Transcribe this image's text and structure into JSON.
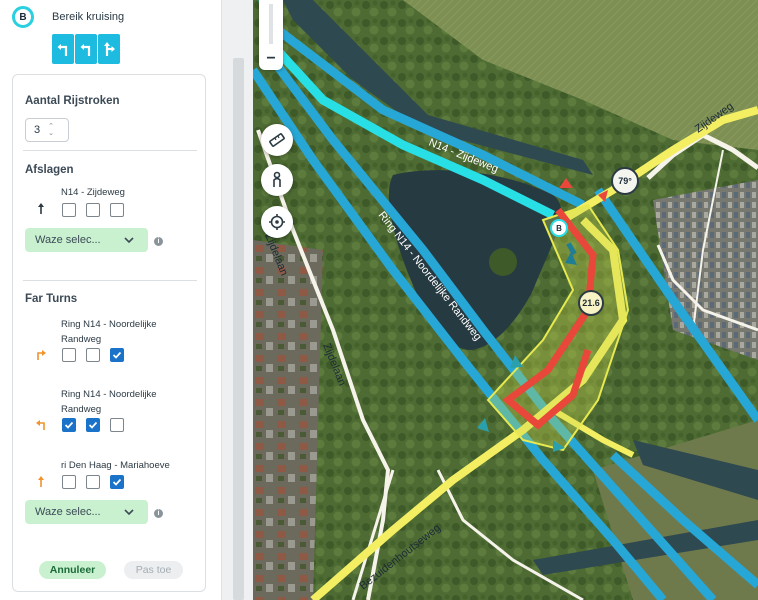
{
  "node": {
    "badge": "B",
    "title": "Bereik kruising",
    "badge_color": "#2ad0e0"
  },
  "lane_icons": [
    "turn-left-icon",
    "turn-left-icon",
    "straight-right-icon"
  ],
  "lanes": {
    "title": "Aantal Rijstroken",
    "value": "3"
  },
  "turns": {
    "title": "Afslagen",
    "road": "N14 - Zijdeweg",
    "arrow_icon": "straight-arrow-icon",
    "checks": [
      false,
      false,
      false
    ],
    "select_label": "Waze selec..."
  },
  "far_turns": {
    "title": "Far Turns",
    "items": [
      {
        "road": "Ring N14 - Noordelijke Randweg",
        "arrow_icon": "turn-right-arrow-icon",
        "arrow_color": "#f0932d",
        "checks": [
          false,
          false,
          true
        ]
      },
      {
        "road": "Ring N14 - Noordelijke Randweg",
        "arrow_icon": "turn-left-arrow-icon",
        "arrow_color": "#f0932d",
        "checks": [
          true,
          true,
          false
        ]
      },
      {
        "road": "ri Den Haag - Mariahoeve",
        "arrow_icon": "straight-arrow-icon",
        "arrow_color": "#f0932d",
        "checks": [
          false,
          false,
          true
        ]
      }
    ],
    "select_label": "Waze selec..."
  },
  "buttons": {
    "cancel": "Annuleer",
    "apply": "Pas toe"
  },
  "map": {
    "labels": {
      "ring": "Ring N14 - Noordelijke Randweg",
      "ring_short": "N14 - Zijdeweg",
      "zijdeweg": "Zijdeweg",
      "zijdelaan": "Zijdelaan",
      "zijdelaan_top": "Zijdelaan",
      "bezuidenhout": "Bezuidenhoutseweg"
    },
    "angle_bubble": "79°",
    "speed_bubble": "21.6",
    "node_marker": "B",
    "colors": {
      "highway": "#27a7d6",
      "highway_selected": "#28dfe6",
      "primary": "#f4ef62",
      "street": "#f5f3ea",
      "segment_selected": "#e8473a",
      "intersection": "#e6e94f"
    }
  }
}
